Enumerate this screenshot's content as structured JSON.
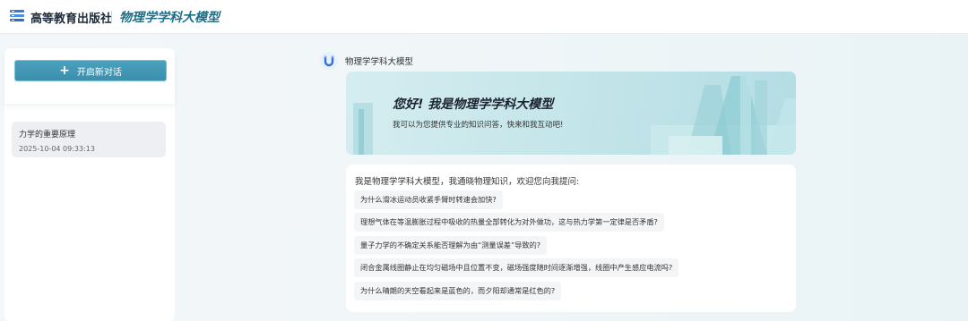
{
  "header": {
    "publisher": "高等教育出版社",
    "app_title": "物理学学科大模型"
  },
  "sidebar": {
    "new_chat_label": "开启新对话",
    "history": [
      {
        "title": "力学的重要原理",
        "time": "2025-10-04 09:33:13"
      }
    ]
  },
  "chat": {
    "bot_name": "物理学学科大模型",
    "banner_title": "您好! 我是物理学学科大模型",
    "banner_subtitle": "我可以为您提供专业的知识问答，快来和我互动吧!",
    "intro": "我是物理学学科大模型，我通晓物理知识，欢迎您向我提问:",
    "questions": [
      "为什么滑冰运动员收紧手臂时转速会加快?",
      "理想气体在等温膨胀过程中吸收的热量全部转化为对外做功，这与热力学第一定律是否矛盾?",
      "量子力学的不确定关系能否理解为由“测量误差”导致的?",
      "闭合金属线圈静止在均匀磁场中且位置不变，磁场强度随时间逐渐增强，线圈中产生感应电流吗?",
      "为什么晴朗的天空看起来是蓝色的，而夕阳却通常是红色的?"
    ]
  },
  "icons": {
    "logo": "books-logo-icon",
    "plus": "plus-icon",
    "bot": "magnet-avatar-icon"
  },
  "colors": {
    "accent": "#3b8fae",
    "title": "#1d6e86"
  }
}
